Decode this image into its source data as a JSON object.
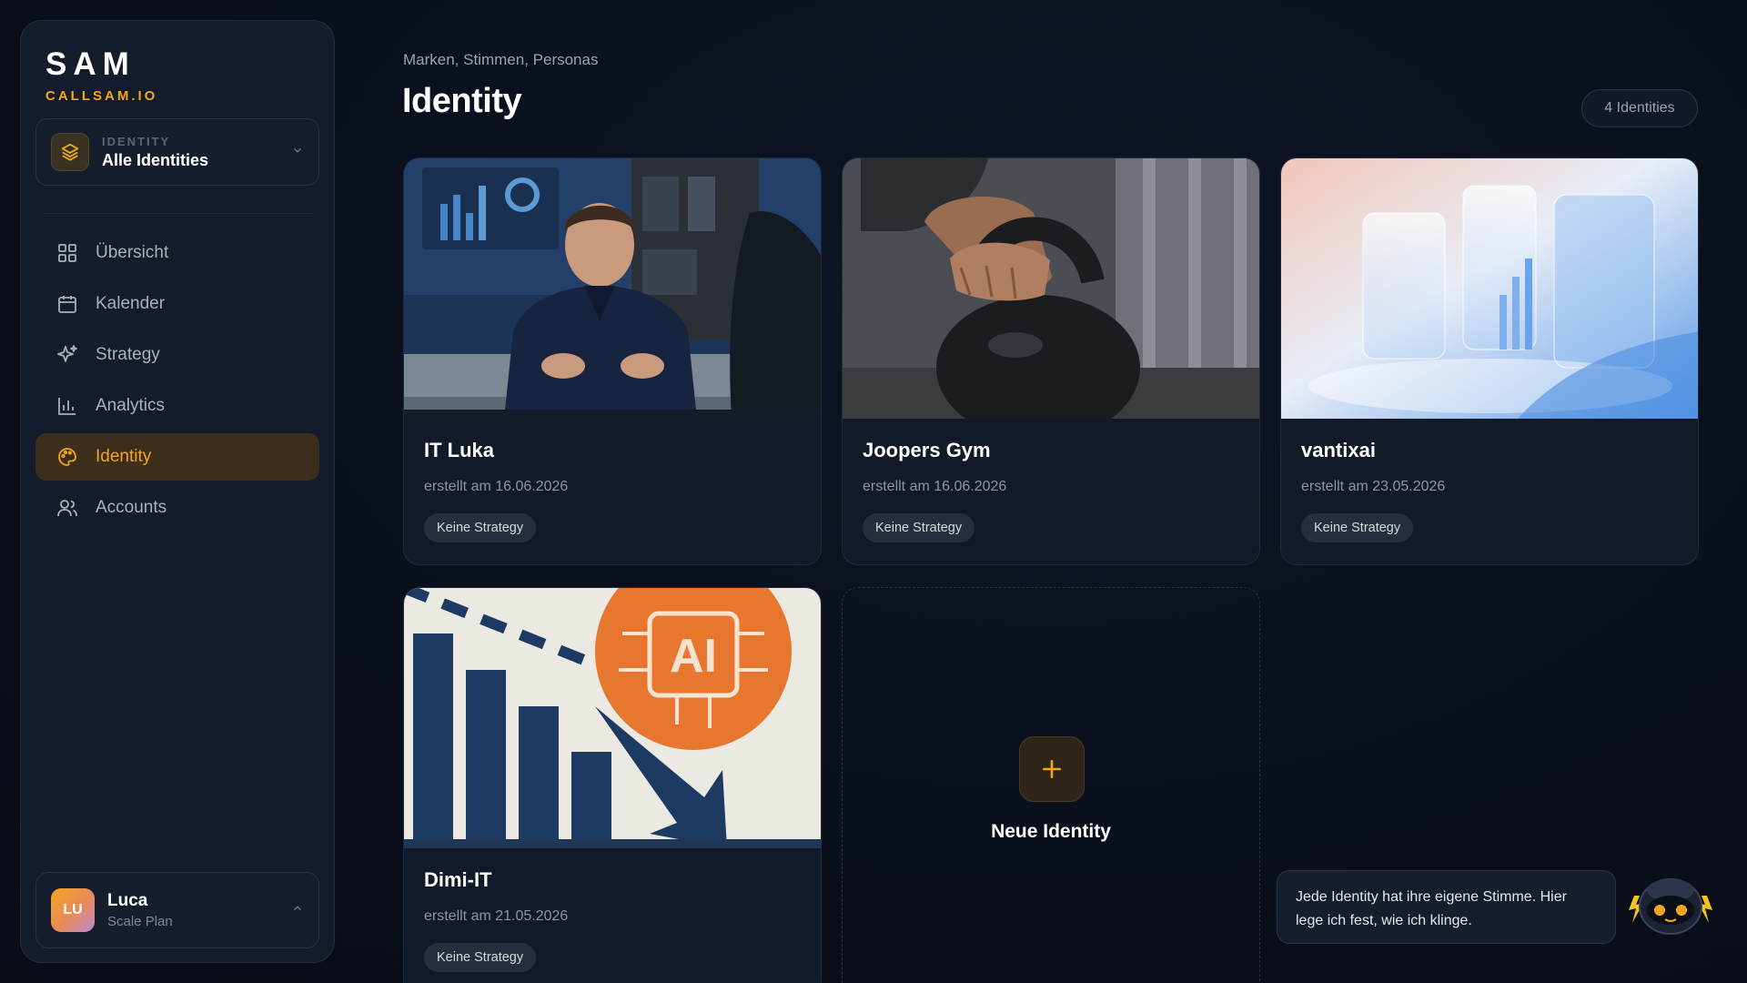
{
  "logo": {
    "title": "SAM",
    "subtitle": "CALLSAM.IO"
  },
  "identity_selector": {
    "label": "IDENTITY",
    "value": "Alle Identities"
  },
  "nav": {
    "items": [
      {
        "label": "Übersicht",
        "icon": "grid-icon",
        "active": false
      },
      {
        "label": "Kalender",
        "icon": "calendar-icon",
        "active": false
      },
      {
        "label": "Strategy",
        "icon": "sparkles-icon",
        "active": false
      },
      {
        "label": "Analytics",
        "icon": "bar-chart-icon",
        "active": false
      },
      {
        "label": "Identity",
        "icon": "palette-icon",
        "active": true
      },
      {
        "label": "Accounts",
        "icon": "users-icon",
        "active": false
      }
    ]
  },
  "user": {
    "initials": "LU",
    "name": "Luca",
    "plan": "Scale Plan"
  },
  "header": {
    "breadcrumb": "Marken, Stimmen, Personas",
    "title": "Identity",
    "count_badge": "4 Identities"
  },
  "cards": [
    {
      "name": "IT Luka",
      "date": "erstellt am 16.06.2026",
      "tag": "Keine Strategy",
      "image": "office-man-photo"
    },
    {
      "name": "Joopers Gym",
      "date": "erstellt am 16.06.2026",
      "tag": "Keine Strategy",
      "image": "kettlebell-photo"
    },
    {
      "name": "vantixai",
      "date": "erstellt am 23.05.2026",
      "tag": "Keine Strategy",
      "image": "abstract-glass-render"
    },
    {
      "name": "Dimi-IT",
      "date": "erstellt am 21.05.2026",
      "tag": "Keine Strategy",
      "image": "ai-chip-bar-chart-photo"
    }
  ],
  "new_identity": {
    "label": "Neue Identity"
  },
  "assistant": {
    "message": "Jede Identity hat ihre eigene Stimme. Hier lege ich fest, wie ich klinge."
  },
  "colors": {
    "accent": "#f2a71f",
    "background": "#0a0f1c",
    "card": "#121929"
  }
}
